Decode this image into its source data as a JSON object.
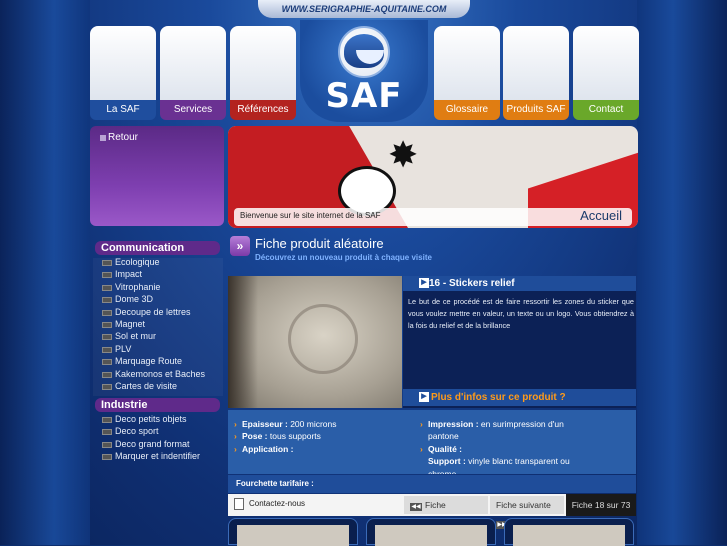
{
  "site_url": "WWW.SERIGRAPHIE-AQUITAINE.COM",
  "logo": {
    "text": "SAF"
  },
  "nav": [
    {
      "label": "La SAF",
      "color": "#1f4e9e"
    },
    {
      "label": "Services",
      "color": "#6a3192"
    },
    {
      "label": "Références",
      "color": "#b3231f"
    },
    {
      "label": "Glossaire",
      "color": "#e07d12"
    },
    {
      "label": "Produits SAF",
      "color": "#e07d12"
    },
    {
      "label": "Contact",
      "color": "#6aa82a"
    }
  ],
  "retour": {
    "label": "Retour"
  },
  "banner": {
    "welcome": "Bienvenue sur le site internet de la SAF",
    "accueil": "Accueil"
  },
  "sidebar": {
    "communication": {
      "title": "Communication",
      "items": [
        "Ecologique",
        "Impact",
        "Vitrophanie",
        "Dome 3D",
        "Decoupe de lettres",
        "Magnet",
        "Sol et mur",
        "PLV",
        "Marquage Route",
        "Kakemonos et Baches",
        "Cartes de visite"
      ]
    },
    "industrie": {
      "title": "Industrie",
      "items": [
        "Deco petits objets",
        "Deco sport",
        "Deco grand format",
        "Marquer et indentifier"
      ]
    }
  },
  "fiche": {
    "title": "Fiche produit aléatoire",
    "subtitle": "Découvrez un nouveau produit à chaque visite"
  },
  "product": {
    "title": "16 - Stickers relief",
    "description": "Le but de ce procédé est de faire ressortir les zones du sticker que vous voulez mettre en valeur, un texte ou un logo. Vous obtiendrez à la fois du relief et de la brillance",
    "more": "Plus d'infos sur ce produit ?"
  },
  "specs": {
    "epaisseur_label": "Epaisseur :",
    "epaisseur_value": "200 microns",
    "pose_label": "Pose :",
    "pose_value": "tous supports",
    "application_label": "Application :",
    "application_value": "",
    "impression_label": "Impression :",
    "impression_value": "en surimpression d'un pantone",
    "qualite_label": "Qualité :",
    "qualite_value": "",
    "support_label": "Support :",
    "support_value": "vinyle blanc transparent ou chrome"
  },
  "tarif": {
    "label": "Fourchette tarifaire :"
  },
  "footer": {
    "contact": "Contactez-nous",
    "prev": "Fiche précédente",
    "next": "Fiche suivante",
    "counter": "Fiche 18 sur 73"
  }
}
